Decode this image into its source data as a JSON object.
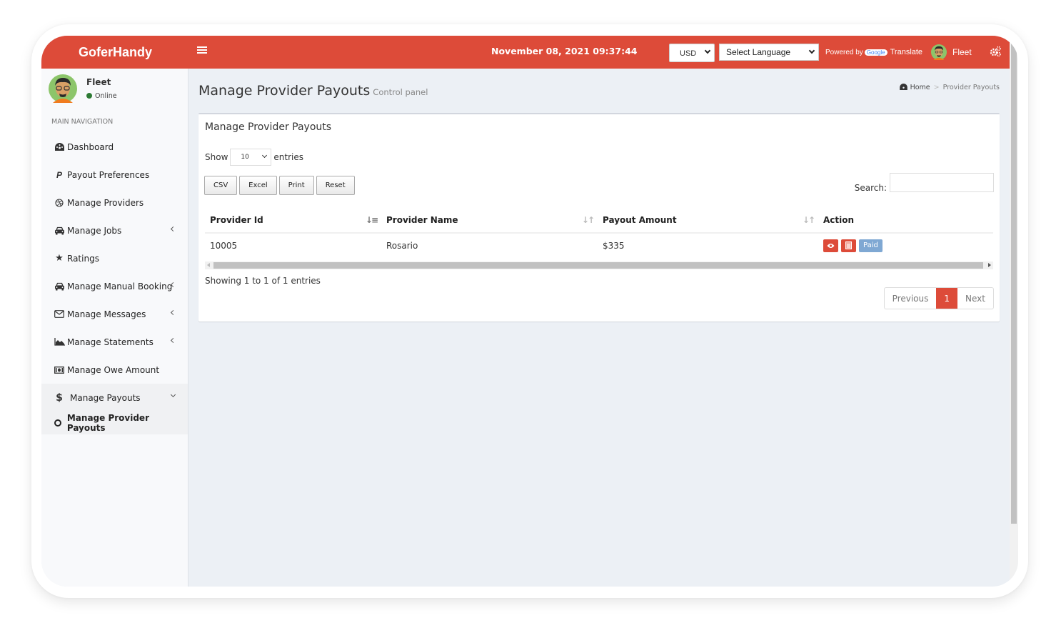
{
  "header": {
    "logo": "GoferHandy",
    "datetime": "November 08, 2021 09:37:44",
    "currency": "USD",
    "language": "Select Language",
    "powered_by": "Powered by",
    "google": "Google",
    "translate": "Translate",
    "user": "Fleet",
    "brand_color": "#dd4b39"
  },
  "sidebar": {
    "user_name": "Fleet",
    "status": "Online",
    "nav_header": "MAIN NAVIGATION",
    "items": [
      {
        "label": "Dashboard",
        "icon": "dashboard-icon"
      },
      {
        "label": "Payout Preferences",
        "icon": "paypal-icon"
      },
      {
        "label": "Manage Providers",
        "icon": "dribbble-icon"
      },
      {
        "label": "Manage Jobs",
        "icon": "taxi-icon"
      },
      {
        "label": "Ratings",
        "icon": "star-icon"
      },
      {
        "label": "Manage Manual Booking",
        "icon": "taxi-icon"
      },
      {
        "label": "Manage Messages",
        "icon": "envelope-icon"
      },
      {
        "label": "Manage Statements",
        "icon": "area-chart-icon"
      },
      {
        "label": "Manage Owe Amount",
        "icon": "money-icon"
      },
      {
        "label": "Manage Payouts",
        "icon": "dollar-icon"
      }
    ],
    "sub_items": [
      {
        "label": "Manage Provider Payouts"
      }
    ]
  },
  "page": {
    "title": "Manage Provider Payouts",
    "subtitle": "Control panel",
    "breadcrumb": {
      "home": "Home",
      "sep": ">",
      "current": "Provider Payouts"
    }
  },
  "box": {
    "title": "Manage Provider Payouts",
    "show_label": "Show",
    "entries_value": "10",
    "entries_label": "entries",
    "buttons": [
      "CSV",
      "Excel",
      "Print",
      "Reset"
    ],
    "search_label": "Search:",
    "search_value": "",
    "columns": [
      "Provider Id",
      "Provider Name",
      "Payout Amount",
      "Action"
    ],
    "rows": [
      {
        "provider_id": "10005",
        "provider_name": "Rosario",
        "payout_amount": "$335",
        "status": "Paid"
      }
    ],
    "info": "Showing 1 to 1 of 1 entries",
    "pagination": {
      "previous": "Previous",
      "current": "1",
      "next": "Next"
    }
  }
}
